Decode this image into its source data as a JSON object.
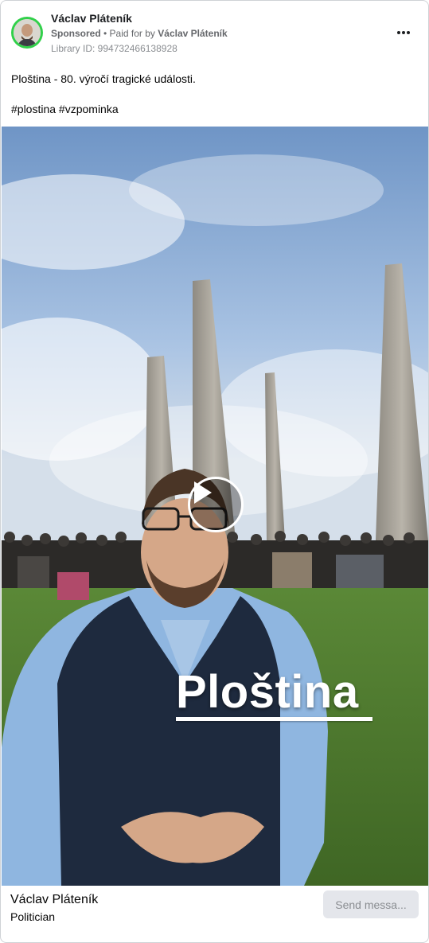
{
  "post": {
    "author": "Václav Pláteník",
    "sponsored": "Sponsored",
    "paid_for_prefix": "• Paid for by",
    "paid_for_name": "Václav Pláteník",
    "library_id": "Library ID: 994732466138928",
    "text_line1": "Ploština - 80. výročí tragické události.",
    "hashtags": "#plostina #vzpominka"
  },
  "media": {
    "overlay_caption": "Ploština"
  },
  "footer": {
    "name": "Václav Pláteník",
    "role": "Politician",
    "send_button": "Send messa..."
  },
  "colors": {
    "avatar_ring": "#31d04a",
    "sky": "#8fb1d9",
    "grass": "#4f7a2e",
    "vest": "#1e2a3e",
    "shirt": "#8fb6e0"
  },
  "icons": {
    "more": "more-horizontal-icon",
    "play": "play-icon"
  }
}
